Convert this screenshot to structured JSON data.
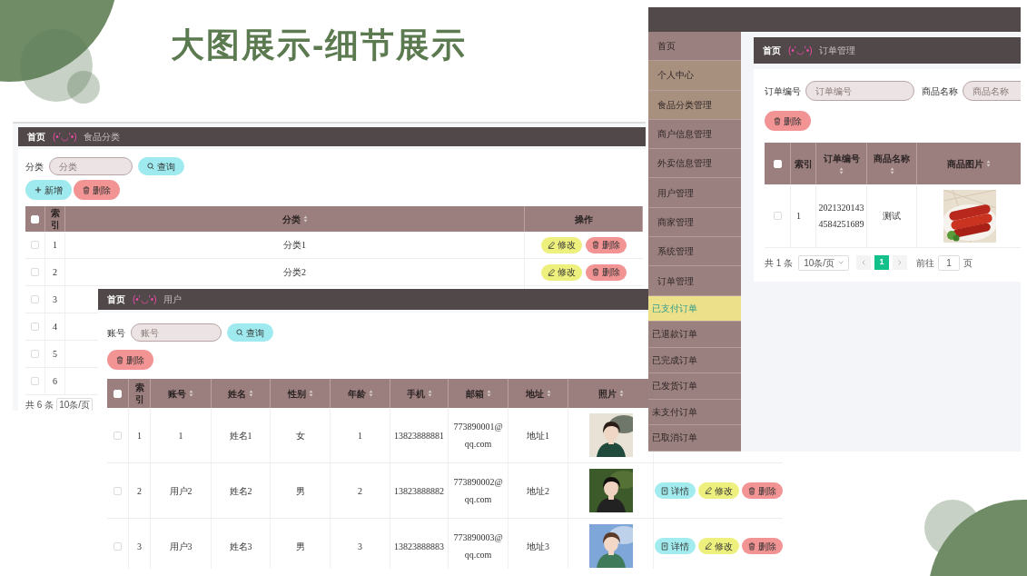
{
  "slide_title": "大图展示-细节展示",
  "category_page": {
    "breadcrumb": {
      "home": "首页",
      "emoticon": "(•'◡'•)",
      "current": "食品分类"
    },
    "search": {
      "label": "分类",
      "placeholder": "分类",
      "button": "查询"
    },
    "select_all": false,
    "buttons": [
      {
        "label": "新增",
        "kind": "add"
      },
      {
        "label": "删除",
        "kind": "delete"
      }
    ],
    "columns": [
      {
        "label": "索引",
        "sortable": false
      },
      {
        "label": "分类",
        "sortable": true
      },
      {
        "label": "操作",
        "sortable": false
      }
    ],
    "rows": [
      {
        "checked": false,
        "index": "1",
        "name": "分类1",
        "actions": [
          {
            "label": "修改",
            "kind": "edit"
          },
          {
            "label": "删除",
            "kind": "delete"
          }
        ]
      },
      {
        "checked": false,
        "index": "2",
        "name": "分类2",
        "actions": [
          {
            "label": "修改",
            "kind": "edit"
          },
          {
            "label": "删除",
            "kind": "delete"
          }
        ]
      },
      {
        "checked": false,
        "index": "3"
      },
      {
        "checked": false,
        "index": "4"
      },
      {
        "checked": false,
        "index": "5"
      },
      {
        "checked": false,
        "index": "6"
      }
    ],
    "pagination": {
      "total": "共 6 条",
      "page_size": "10条/页"
    }
  },
  "user_page": {
    "breadcrumb": {
      "home": "首页",
      "emoticon": "(•'◡'•)",
      "current": "用户"
    },
    "search": {
      "label": "账号",
      "placeholder": "账号",
      "button": "查询"
    },
    "select_all": false,
    "buttons": [
      {
        "label": "删除",
        "kind": "delete"
      }
    ],
    "columns": [
      {
        "label": "索引",
        "sortable": false
      },
      {
        "label": "账号",
        "sortable": true
      },
      {
        "label": "姓名",
        "sortable": true
      },
      {
        "label": "性别",
        "sortable": true
      },
      {
        "label": "年龄",
        "sortable": true
      },
      {
        "label": "手机",
        "sortable": true
      },
      {
        "label": "邮箱",
        "sortable": true
      },
      {
        "label": "地址",
        "sortable": true
      },
      {
        "label": "照片",
        "sortable": true
      }
    ],
    "rows": [
      {
        "checked": false,
        "index": "1",
        "account": "1",
        "name": "姓名1",
        "gender": "女",
        "age": "1",
        "phone": "13823888881",
        "email": "773890001@qq.com",
        "address": "地址1"
      },
      {
        "checked": false,
        "index": "2",
        "account": "用户2",
        "name": "姓名2",
        "gender": "男",
        "age": "2",
        "phone": "13823888882",
        "email": "773890002@qq.com",
        "address": "地址2",
        "actions": [
          {
            "label": "详情",
            "kind": "detail"
          },
          {
            "label": "修改",
            "kind": "edit"
          },
          {
            "label": "删除",
            "kind": "delete"
          }
        ]
      },
      {
        "checked": false,
        "index": "3",
        "account": "用户3",
        "name": "姓名3",
        "gender": "男",
        "age": "3",
        "phone": "13823888883",
        "email": "773890003@qq.com",
        "address": "地址3",
        "actions": [
          {
            "label": "详情",
            "kind": "detail"
          },
          {
            "label": "修改",
            "kind": "edit"
          },
          {
            "label": "删除",
            "kind": "delete"
          }
        ]
      }
    ]
  },
  "order_page": {
    "sidebar": [
      {
        "label": "首页",
        "kind": "menu",
        "selected": false,
        "highlighted": false
      },
      {
        "label": "个人中心",
        "kind": "menu",
        "selected": false,
        "highlighted": true
      },
      {
        "label": "食品分类管理",
        "kind": "menu",
        "selected": false,
        "highlighted": true
      },
      {
        "label": "商户信息管理",
        "kind": "menu",
        "selected": false,
        "highlighted": false
      },
      {
        "label": "外卖信息管理",
        "kind": "menu",
        "selected": false,
        "highlighted": false
      },
      {
        "label": "用户管理",
        "kind": "menu",
        "selected": false,
        "highlighted": false
      },
      {
        "label": "商家管理",
        "kind": "menu",
        "selected": false,
        "highlighted": false
      },
      {
        "label": "系统管理",
        "kind": "menu",
        "selected": false,
        "highlighted": false
      },
      {
        "label": "订单管理",
        "kind": "menu",
        "selected": false,
        "highlighted": false
      },
      {
        "label": "已支付订单",
        "kind": "submenu",
        "selected": true,
        "highlighted": false
      },
      {
        "label": "已退款订单",
        "kind": "submenu",
        "selected": false,
        "highlighted": false
      },
      {
        "label": "已完成订单",
        "kind": "submenu",
        "selected": false,
        "highlighted": false
      },
      {
        "label": "已发货订单",
        "kind": "submenu",
        "selected": false,
        "highlighted": false
      },
      {
        "label": "未支付订单",
        "kind": "submenu",
        "selected": false,
        "highlighted": false
      },
      {
        "label": "已取消订单",
        "kind": "submenu",
        "selected": false,
        "highlighted": false
      }
    ],
    "breadcrumb": {
      "home": "首页",
      "emoticon": "(•'◡'•)",
      "current": "订单管理"
    },
    "select_all": false,
    "search_fields": [
      {
        "label": "订单编号",
        "placeholder": "订单编号"
      },
      {
        "label": "商品名称",
        "placeholder": "商品名称"
      }
    ],
    "buttons": [
      {
        "label": "删除",
        "kind": "delete"
      }
    ],
    "columns": [
      {
        "label": "索引",
        "sortable": false
      },
      {
        "label": "订单编号",
        "sortable": true
      },
      {
        "label": "商品名称",
        "sortable": true
      },
      {
        "label": "商品图片",
        "sortable": true
      }
    ],
    "rows": [
      {
        "checked": false,
        "index": "1",
        "order_no": "20213201434584251689",
        "product": "测试"
      }
    ],
    "pagination": {
      "total": "共 1 条",
      "page_size": "10条/页",
      "pages": [
        {
          "label": "1",
          "selected": true
        }
      ],
      "goto_label": "前往",
      "goto_value": "1",
      "goto_suffix": "页"
    }
  }
}
